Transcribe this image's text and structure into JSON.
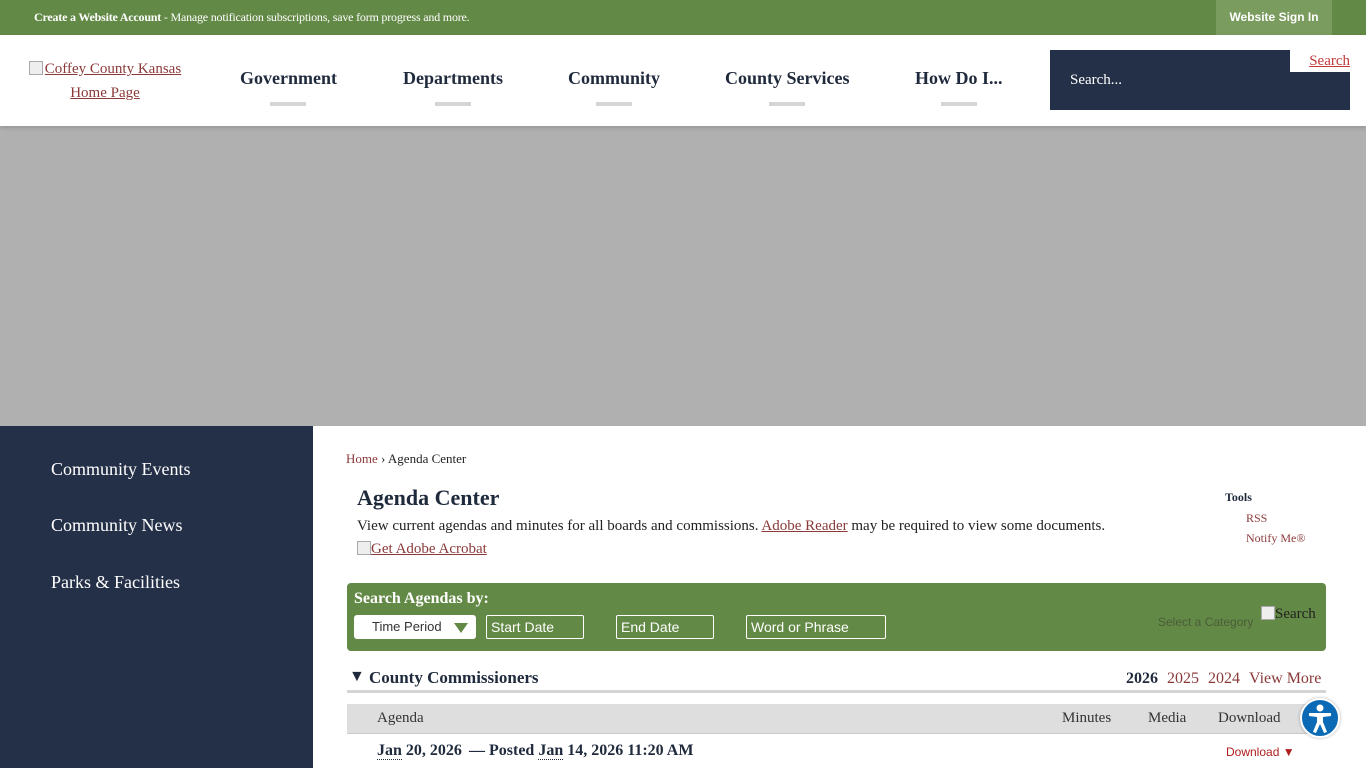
{
  "topbar": {
    "create_account": "Create a Website Account",
    "message": " - Manage notification subscriptions, save form progress and more.",
    "sign_in": "Website Sign In"
  },
  "header": {
    "logo_alt": "Coffey County Kansas Home Page",
    "nav": [
      "Government",
      "Departments",
      "Community",
      "County Services",
      "How Do I..."
    ],
    "search_placeholder": "Search...",
    "search_button": "Search"
  },
  "sidebar": {
    "items": [
      "Community Events",
      "Community News",
      "Parks & Facilities"
    ]
  },
  "breadcrumb": {
    "home": "Home",
    "separator": "›",
    "current": "Agenda Center"
  },
  "main": {
    "title": "Agenda Center",
    "intro_before": "View current agendas and minutes for all boards and commissions. ",
    "intro_link": "Adobe Reader",
    "intro_after": " may be required to view some documents.",
    "acrobat_alt": "Get Adobe Acrobat"
  },
  "tools": {
    "title": "Tools",
    "links": [
      "RSS",
      "Notify Me®"
    ]
  },
  "search_panel": {
    "label": "Search Agendas by:",
    "time_period": "Time Period",
    "start_date": "Start Date",
    "end_date": "End Date",
    "phrase": "Word or Phrase",
    "category": "Select a Category",
    "search_alt": "Search"
  },
  "agenda_group": {
    "name": "County Commissioners",
    "years": [
      "2026",
      "2025",
      "2024"
    ],
    "view_more": "View More",
    "columns": [
      "Agenda",
      "Minutes",
      "Media",
      "Download"
    ],
    "rows": [
      {
        "date_month": "Jan",
        "date_rest": " 20, 2026",
        "posted_prefix": "— Posted ",
        "posted_month": "Jan",
        "posted_rest": " 14, 2026 11:20 AM",
        "download": "Download ▼"
      }
    ]
  },
  "colors": {
    "topbar_green": "#638946",
    "navy": "#243047",
    "link_red": "#8b3a3a"
  }
}
